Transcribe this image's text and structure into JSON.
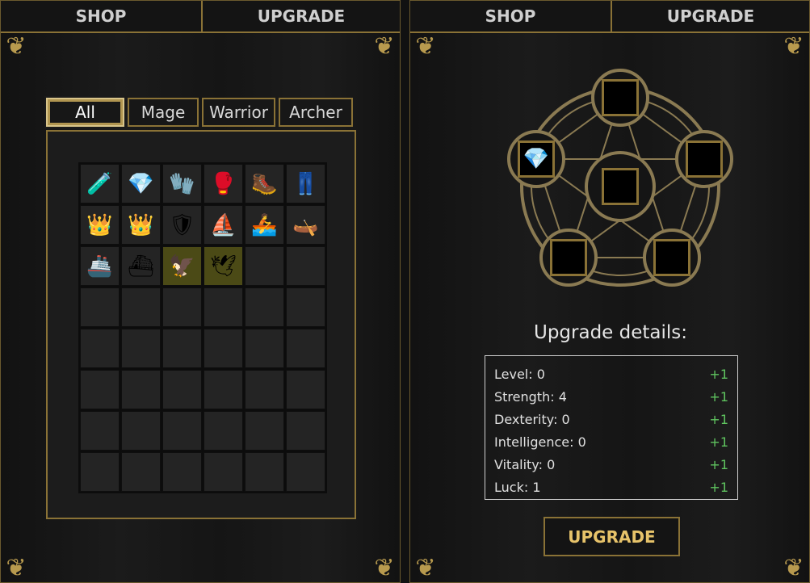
{
  "left_panel": {
    "tabs": {
      "shop": "SHOP",
      "upgrade": "UPGRADE"
    },
    "filters": [
      "All",
      "Mage",
      "Warrior",
      "Archer"
    ],
    "active_filter": "All",
    "items": [
      {
        "icon": "red-potion-icon",
        "glyph": "🧪"
      },
      {
        "icon": "diamond-ore-icon",
        "glyph": "💎"
      },
      {
        "icon": "green-glove-icon",
        "glyph": "🧤"
      },
      {
        "icon": "gauntlet-icon",
        "glyph": "🥊"
      },
      {
        "icon": "steel-boot-icon",
        "glyph": "🥾"
      },
      {
        "icon": "leather-pants-icon",
        "glyph": "👖"
      },
      {
        "icon": "gold-crown-icon",
        "glyph": "👑"
      },
      {
        "icon": "jeweled-crown-icon",
        "glyph": "👑"
      },
      {
        "icon": "wooden-shield-icon",
        "glyph": "🛡"
      },
      {
        "icon": "small-boat-icon",
        "glyph": "⛵"
      },
      {
        "icon": "rowboat-icon",
        "glyph": "🚣"
      },
      {
        "icon": "canoe-icon",
        "glyph": "🛶"
      },
      {
        "icon": "galleon-icon",
        "glyph": "🚢"
      },
      {
        "icon": "warship-icon",
        "glyph": "⛴"
      },
      {
        "icon": "red-wings-icon",
        "glyph": "🦅",
        "highlight": true
      },
      {
        "icon": "white-wings-icon",
        "glyph": "🕊",
        "highlight": true
      }
    ],
    "total_slots": 48
  },
  "right_panel": {
    "tabs": {
      "shop": "SHOP",
      "upgrade": "UPGRADE"
    },
    "center_item": {
      "icon": "sword-icon",
      "glyph": "🗡"
    },
    "slot_left_item": {
      "icon": "diamond-ore-icon",
      "glyph": "💎"
    },
    "details_title": "Upgrade details:",
    "stats": [
      {
        "label": "Level: 0",
        "bonus": "+1"
      },
      {
        "label": "Strength: 4",
        "bonus": "+1"
      },
      {
        "label": "Dexterity: 0",
        "bonus": "+1"
      },
      {
        "label": "Intelligence: 0",
        "bonus": "+1"
      },
      {
        "label": "Vitality: 0",
        "bonus": "+1"
      },
      {
        "label": "Luck: 1",
        "bonus": "+1"
      }
    ],
    "upgrade_button": "UPGRADE"
  },
  "colors": {
    "gold": "#8a7236",
    "bonus_green": "#5fc45f",
    "button_text": "#e7c36a"
  }
}
